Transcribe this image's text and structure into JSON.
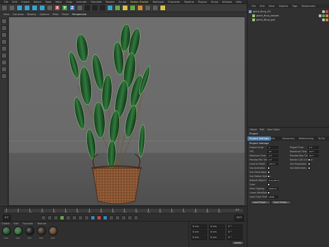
{
  "menubar": {
    "items": [
      "File",
      "Edit",
      "Create",
      "Select",
      "Tools",
      "Mesh",
      "Snap",
      "Animate",
      "Simulate",
      "Render",
      "Sculpt",
      "Motion Tracker",
      "MoGraph",
      "Character",
      "Pipeline",
      "Plugins",
      "Script",
      "Window",
      "Help"
    ],
    "highlighted": "Motion Tracker"
  },
  "viewport_menu": {
    "items": [
      "View",
      "Cameras",
      "Display",
      "Options",
      "Filter",
      "Panel"
    ],
    "active": "Perspective"
  },
  "timeline": {
    "ticks": [
      "0",
      "5",
      "10",
      "15",
      "20",
      "25",
      "30",
      "35",
      "40",
      "45",
      "50",
      "55",
      "60",
      "65",
      "70",
      "75",
      "80",
      "85",
      "90"
    ],
    "frame_readout": "0 F",
    "start": "0 F",
    "end": "90 F"
  },
  "materials": {
    "menu": [
      "Create",
      "Edit",
      "Function",
      "Texture"
    ],
    "swatches": [
      {
        "name": "Mat",
        "color": "#2f6b3a"
      },
      {
        "name": "Mat",
        "color": "#3d8246"
      },
      {
        "name": "Mat",
        "color": "#2a2a2a"
      },
      {
        "name": "Mat",
        "color": "#4a3a2e"
      },
      {
        "name": "Mat",
        "color": "#7a5236"
      }
    ]
  },
  "coords": {
    "rows": [
      {
        "a": "0 cm",
        "b": "0 cm",
        "c": "0 °"
      },
      {
        "a": "0 cm",
        "b": "0 cm",
        "c": "0 °"
      },
      {
        "a": "0 cm",
        "b": "0 cm",
        "c": "0 °"
      }
    ],
    "apply": "Apply"
  },
  "object_manager": {
    "menu": [
      "File",
      "Edit",
      "View",
      "Objects",
      "Tags",
      "Bookmarks"
    ],
    "objects": [
      "plant_ficus_03",
      "plant_ficus_leaves",
      "plant_ficus_pot"
    ]
  },
  "attribute_manager": {
    "menu": [
      "Mode",
      "Edit",
      "User Data"
    ],
    "title": "Project",
    "tabs": [
      "Project Settings",
      "Info",
      "Dynamics",
      "Referencing",
      "To Do"
    ],
    "section": "Project Settings",
    "rows": [
      {
        "label": "Project Scale",
        "value": "1"
      },
      {
        "label": "FPS",
        "value": "30"
      },
      {
        "label": "Minimum Time",
        "value": "0 F"
      },
      {
        "label": "Preview Min Time",
        "value": "0 F"
      },
      {
        "label": "Level of Detail",
        "value": "100 %"
      },
      {
        "label": "Use Animation",
        "value": ""
      },
      {
        "label": "Use Generators",
        "value": ""
      },
      {
        "label": "Use Motion System",
        "value": ""
      },
      {
        "label": "Default Object Color",
        "value": "Gray-Blue"
      },
      {
        "label": "Color",
        "value": ""
      },
      {
        "label": "View Clipping",
        "value": "Medium"
      },
      {
        "label": "Linear Workflow",
        "value": ""
      },
      {
        "label": "Input Color Profile",
        "value": "sRGB"
      }
    ],
    "right_rows": [
      {
        "label": "Project Time",
        "value": "0 F"
      },
      {
        "label": "Maximum Time",
        "value": "90 F"
      },
      {
        "label": "Preview Max Time",
        "value": "90 F"
      },
      {
        "label": "Render LOD in Editor",
        "value": ""
      },
      {
        "label": "Use Expression",
        "value": ""
      },
      {
        "label": "Use Deformers",
        "value": ""
      }
    ],
    "buttons": [
      "Load Preset...",
      "Save Preset..."
    ]
  }
}
